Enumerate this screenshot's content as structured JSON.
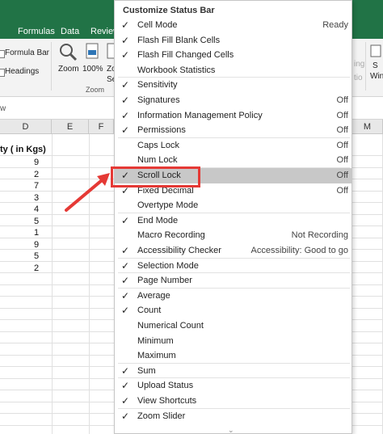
{
  "ribbon": {
    "tabs": [
      "Formulas",
      "Data",
      "Review"
    ],
    "left_labels": {
      "formula_bar": "Formula Bar",
      "headings": "Headings"
    },
    "zoom_buttons": {
      "zoom": "Zoom",
      "hundred": "100%",
      "zoom_sel_top": "Zoo",
      "zoom_sel_bottom": "Sele"
    },
    "group_zoom": "Zoom",
    "right_labels": {
      "r1": "ing",
      "r2": "tio",
      "r3": "S",
      "r4": "Win"
    }
  },
  "grid": {
    "columns": [
      {
        "label": "D",
        "w": 0
      },
      {
        "label": "E"
      },
      {
        "label": "F"
      },
      {
        "label": "M"
      }
    ],
    "header_text": "ty ( in Kgs)",
    "values": [
      "9",
      "2",
      "7",
      "3",
      "4",
      "5",
      "1",
      "9",
      "5",
      "2"
    ]
  },
  "menu": {
    "title": "Customize Status Bar",
    "items": [
      {
        "label": "Cell Mode",
        "value": "Ready",
        "checked": true
      },
      {
        "label": "Flash Fill Blank Cells",
        "value": "",
        "checked": true
      },
      {
        "label": "Flash Fill Changed Cells",
        "value": "",
        "checked": true
      },
      {
        "label": "Workbook Statistics",
        "value": "",
        "checked": false
      },
      {
        "label": "Sensitivity",
        "value": "",
        "checked": true
      },
      {
        "label": "Signatures",
        "value": "Off",
        "checked": true
      },
      {
        "label": "Information Management Policy",
        "value": "Off",
        "checked": true
      },
      {
        "label": "Permissions",
        "value": "Off",
        "checked": true
      },
      {
        "label": "Caps Lock",
        "value": "Off",
        "checked": false
      },
      {
        "label": "Num Lock",
        "value": "Off",
        "checked": false
      },
      {
        "label": "Scroll Lock",
        "value": "Off",
        "checked": true,
        "selected": true
      },
      {
        "label": "Fixed Decimal",
        "value": "Off",
        "checked": true
      },
      {
        "label": "Overtype Mode",
        "value": "",
        "checked": false
      },
      {
        "label": "End Mode",
        "value": "",
        "checked": true
      },
      {
        "label": "Macro Recording",
        "value": "Not Recording",
        "checked": false
      },
      {
        "label": "Accessibility Checker",
        "value": "Accessibility: Good to go",
        "checked": true
      },
      {
        "label": "Selection Mode",
        "value": "",
        "checked": true
      },
      {
        "label": "Page Number",
        "value": "",
        "checked": true
      },
      {
        "label": "Average",
        "value": "",
        "checked": true
      },
      {
        "label": "Count",
        "value": "",
        "checked": true
      },
      {
        "label": "Numerical Count",
        "value": "",
        "checked": false
      },
      {
        "label": "Minimum",
        "value": "",
        "checked": false
      },
      {
        "label": "Maximum",
        "value": "",
        "checked": false
      },
      {
        "label": "Sum",
        "value": "",
        "checked": true
      },
      {
        "label": "Upload Status",
        "value": "",
        "checked": true
      },
      {
        "label": "View Shortcuts",
        "value": "",
        "checked": true
      },
      {
        "label": "Zoom Slider",
        "value": "",
        "checked": true
      }
    ]
  },
  "colors": {
    "ribbon_green": "#217346",
    "annotation_red": "#e53935",
    "selected_bg": "#c8c8c8"
  }
}
